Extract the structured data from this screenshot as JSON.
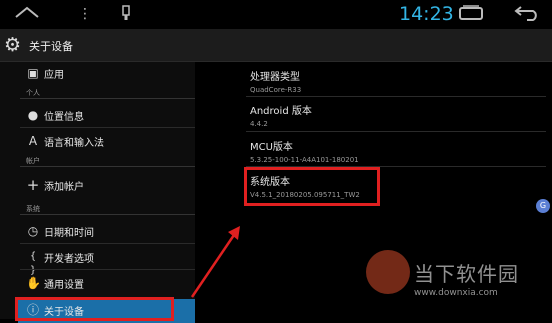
{
  "status_bar": {
    "time": "14:23",
    "icons": [
      "home-icon",
      "more-icon",
      "usb-icon",
      "recents-icon",
      "back-icon"
    ]
  },
  "action_bar": {
    "title": "关于设备",
    "icon": "gear-icon"
  },
  "sidebar": {
    "top_item": {
      "label": "应用",
      "icon": "apps-icon"
    },
    "section_personal": "个人",
    "personal_items": [
      {
        "label": "位置信息",
        "icon": "location-icon"
      },
      {
        "label": "语言和输入法",
        "icon": "language-icon"
      }
    ],
    "section_accounts": "帐户",
    "account_items": [
      {
        "label": "添加帐户",
        "icon": "add-icon"
      }
    ],
    "section_system": "系统",
    "system_items": [
      {
        "label": "日期和时间",
        "icon": "clock-icon"
      },
      {
        "label": "开发者选项",
        "icon": "braces-icon"
      },
      {
        "label": "通用设置",
        "icon": "hand-icon"
      },
      {
        "label": "关于设备",
        "icon": "info-icon",
        "selected": true
      }
    ]
  },
  "details": {
    "items": [
      {
        "title": "处理器类型",
        "value": "QuadCore-R33"
      },
      {
        "title": "Android 版本",
        "value": "4.4.2"
      },
      {
        "title": "MCU版本",
        "value": "5.3.25-100-11-A4A101-180201"
      },
      {
        "title": "系统版本",
        "value": "V4.5.1_20180205.095711_TW2"
      }
    ]
  },
  "watermark": {
    "brand": "当下软件园",
    "url": "www.downxia.com"
  },
  "colors": {
    "accent": "#33b5e5",
    "selected": "#1b6fa8",
    "annotation": "#e02020"
  }
}
